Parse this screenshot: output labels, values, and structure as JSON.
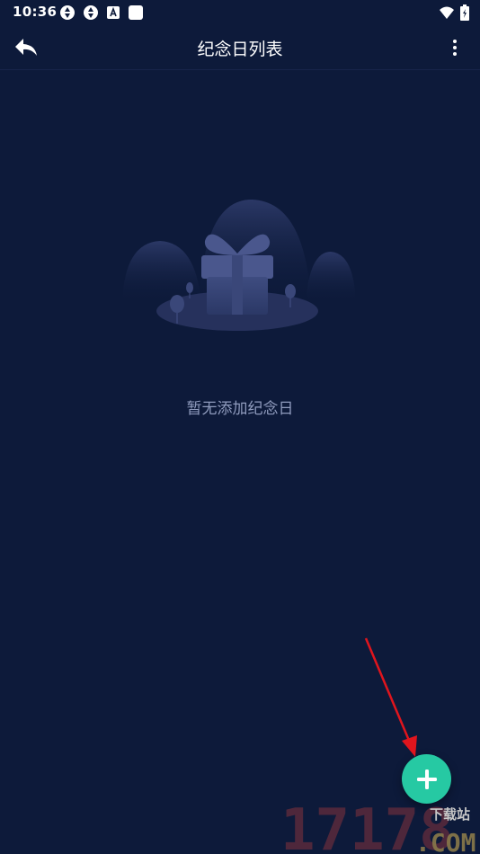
{
  "status_bar": {
    "time": "10:36"
  },
  "toolbar": {
    "title": "纪念日列表"
  },
  "empty_state": {
    "message": "暂无添加纪念日"
  },
  "watermark": {
    "number": "17178",
    "domain": ".COM",
    "site_label": "下载站"
  },
  "colors": {
    "background": "#0d1a3a",
    "fab": "#26c9a3",
    "empty_text": "#8f9bbd",
    "annotation_arrow": "#e0151d"
  },
  "icons": [
    "back-arrow-icon",
    "more-vert-icon",
    "plus-icon",
    "wifi-icon",
    "battery-icon"
  ]
}
